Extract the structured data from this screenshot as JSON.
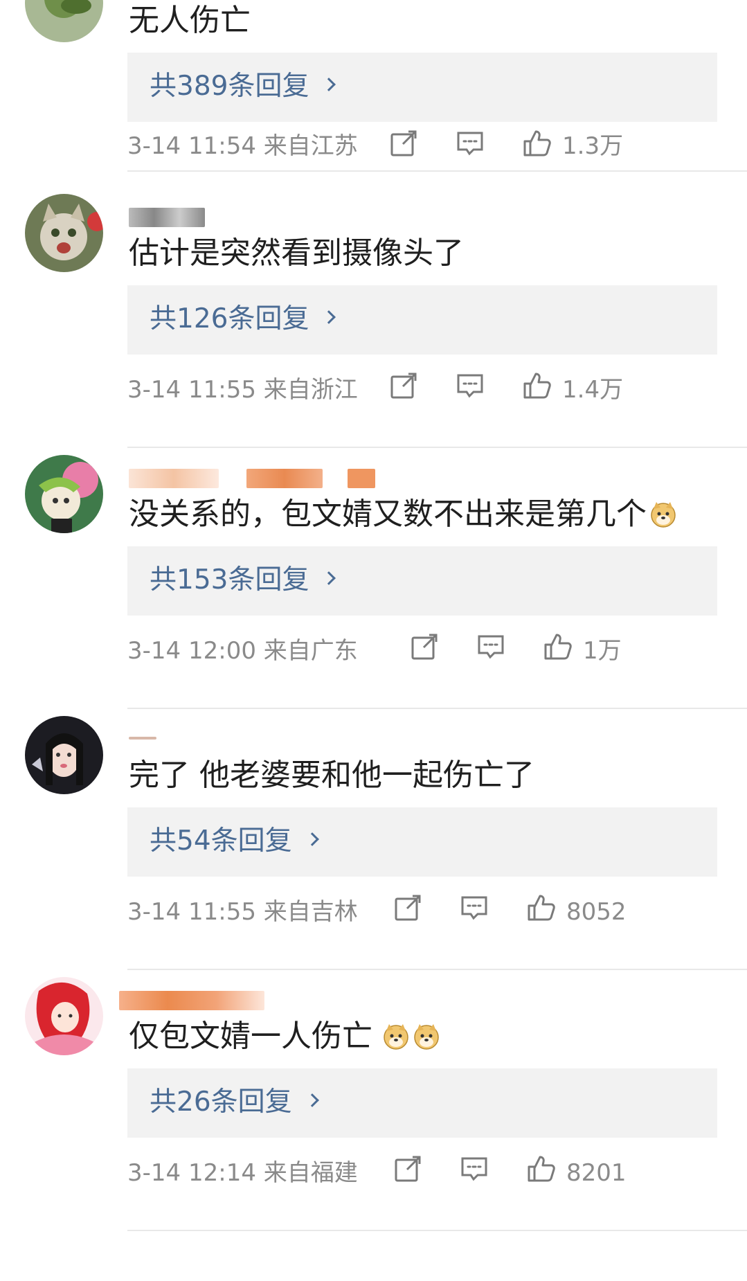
{
  "comments": [
    {
      "text": "无人伤亡",
      "reply_label": "共389条回复",
      "time": "3-14 11:54",
      "location": "来自江苏",
      "likes": "1.3万"
    },
    {
      "text": "估计是突然看到摄像头了",
      "reply_label": "共126条回复",
      "time": "3-14 11:55",
      "location": "来自浙江",
      "likes": "1.4万"
    },
    {
      "text": "没关系的，包文婧又数不出来是第几个",
      "emoji": "doge-emoji",
      "reply_label": "共153条回复",
      "time": "3-14 12:00",
      "location": "来自广东",
      "likes": "1万"
    },
    {
      "text": "完了 他老婆要和他一起伤亡了",
      "reply_label": "共54条回复",
      "time": "3-14 11:55",
      "location": "来自吉林",
      "likes": "8052"
    },
    {
      "text": "仅包文婧一人伤亡",
      "emoji": "doge-emoji",
      "reply_label": "共26条回复",
      "time": "3-14 12:14",
      "location": "来自福建",
      "likes": "8201"
    }
  ],
  "icons": {
    "share": "share-icon",
    "comment": "comment-icon",
    "like": "thumbs-up-icon"
  },
  "colors": {
    "reply_link": "#4a6b94",
    "meta_text": "#8a8a8a",
    "reply_bg": "#f2f2f2"
  }
}
